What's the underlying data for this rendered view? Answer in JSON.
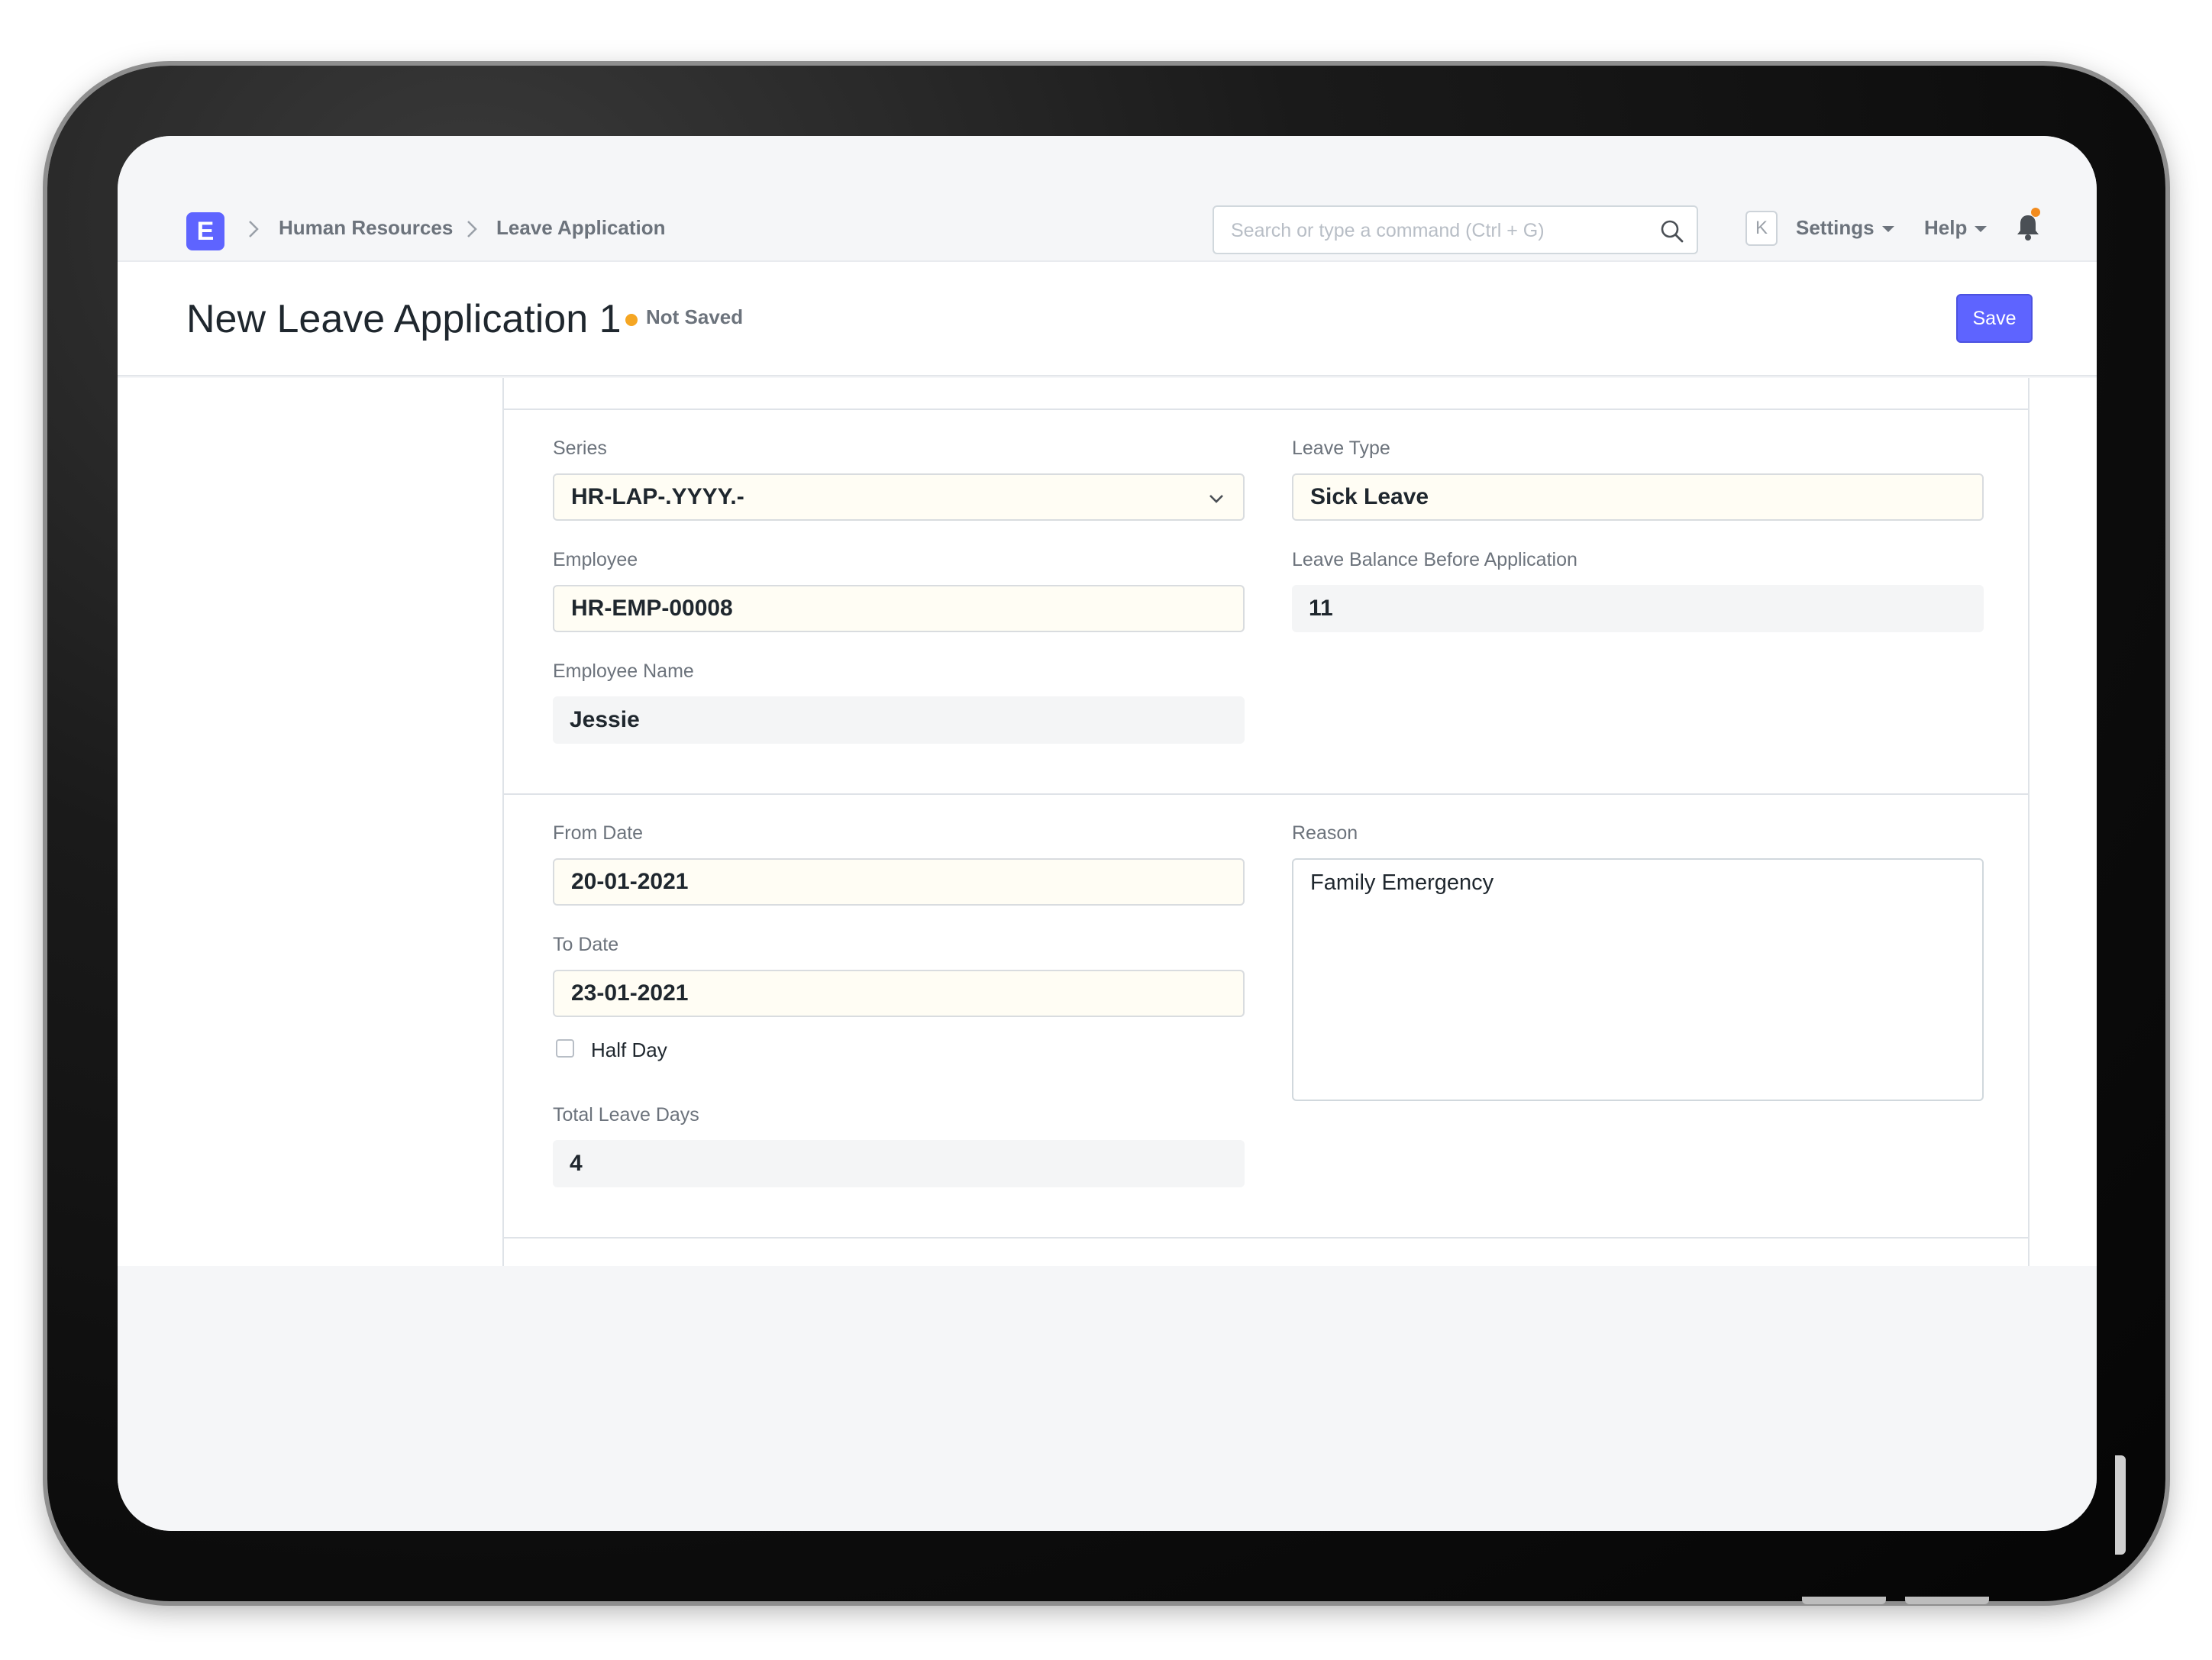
{
  "navbar": {
    "logo_letter": "E",
    "breadcrumbs": [
      "Human Resources",
      "Leave Application"
    ],
    "search_placeholder": "Search or type a command (Ctrl + G)",
    "kbd_hint": "K",
    "settings_label": "Settings",
    "help_label": "Help"
  },
  "page": {
    "title": "New Leave Application 1",
    "status": "Not Saved",
    "save_label": "Save"
  },
  "form": {
    "series": {
      "label": "Series",
      "value": "HR-LAP-.YYYY.-"
    },
    "leave_type": {
      "label": "Leave Type",
      "value": "Sick Leave"
    },
    "employee": {
      "label": "Employee",
      "value": "HR-EMP-00008"
    },
    "leave_balance": {
      "label": "Leave Balance Before Application",
      "value": "11"
    },
    "employee_name": {
      "label": "Employee Name",
      "value": "Jessie"
    },
    "from_date": {
      "label": "From Date",
      "value": "20-01-2021"
    },
    "to_date": {
      "label": "To Date",
      "value": "23-01-2021"
    },
    "half_day": {
      "label": "Half Day",
      "checked": false
    },
    "total_leave_days": {
      "label": "Total Leave Days",
      "value": "4"
    },
    "reason": {
      "label": "Reason",
      "value": "Family Emergency"
    }
  },
  "colors": {
    "accent": "#5e64ff",
    "status_dot": "#f5a623",
    "notification_dot": "#f28b1e"
  }
}
